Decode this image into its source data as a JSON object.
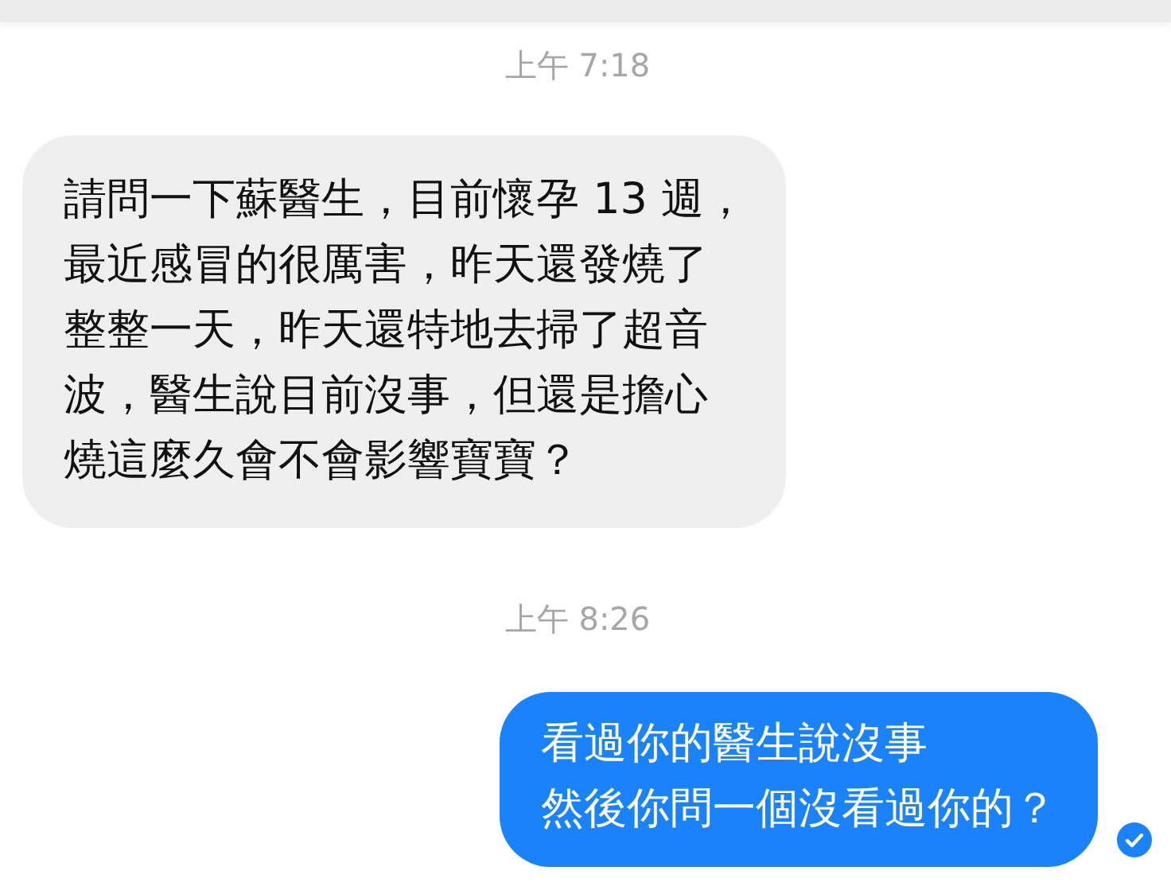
{
  "messages": [
    {
      "kind": "time",
      "text": "上午 7:18"
    },
    {
      "kind": "incoming",
      "lines": [
        "請問一下蘇醫生，目前懷孕 13 週，",
        "最近感冒的很厲害，昨天還發燒了",
        "整整一天，昨天還特地去掃了超音",
        "波，醫生說目前沒事，但還是擔心",
        "燒這麼久會不會影響寶寶？"
      ]
    },
    {
      "kind": "time",
      "text": "上午 8:26"
    },
    {
      "kind": "outgoing",
      "lines": [
        "看過你的醫生說沒事",
        "然後你問一個沒看過你的？"
      ],
      "seen": true
    }
  ]
}
